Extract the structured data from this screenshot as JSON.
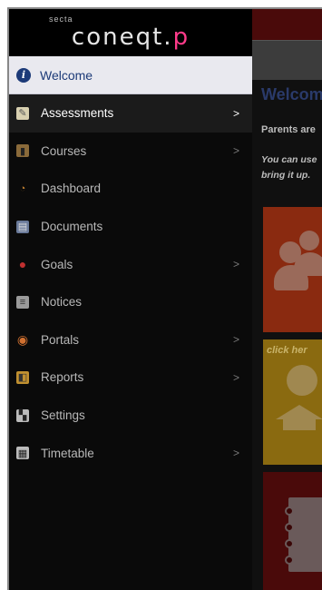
{
  "sidebar": {
    "logo_small": "secta",
    "logo_main": "coneqt.",
    "logo_accent": "p",
    "welcome": {
      "label": "Welcome",
      "icon": "info-icon"
    },
    "items": [
      {
        "label": "Assessments",
        "icon": "assessments-icon",
        "has_submenu": true,
        "active": true
      },
      {
        "label": "Courses",
        "icon": "courses-icon",
        "has_submenu": true,
        "active": false
      },
      {
        "label": "Dashboard",
        "icon": "dashboard-icon",
        "has_submenu": false,
        "active": false
      },
      {
        "label": "Documents",
        "icon": "documents-icon",
        "has_submenu": false,
        "active": false
      },
      {
        "label": "Goals",
        "icon": "goals-icon",
        "has_submenu": true,
        "active": false
      },
      {
        "label": "Notices",
        "icon": "notices-icon",
        "has_submenu": false,
        "active": false
      },
      {
        "label": "Portals",
        "icon": "portals-icon",
        "has_submenu": true,
        "active": false
      },
      {
        "label": "Reports",
        "icon": "reports-icon",
        "has_submenu": true,
        "active": false
      },
      {
        "label": "Settings",
        "icon": "settings-icon",
        "has_submenu": false,
        "active": false
      },
      {
        "label": "Timetable",
        "icon": "timetable-icon",
        "has_submenu": true,
        "active": false
      }
    ],
    "chevron": ">"
  },
  "content": {
    "title": "Welcom",
    "line1": "Parents are",
    "line2": "You can use",
    "line3": "bring it up.",
    "tile2_text": "click her"
  },
  "colors": {
    "accent": "#1c3a78",
    "logo_accent": "#ff3b8a"
  }
}
